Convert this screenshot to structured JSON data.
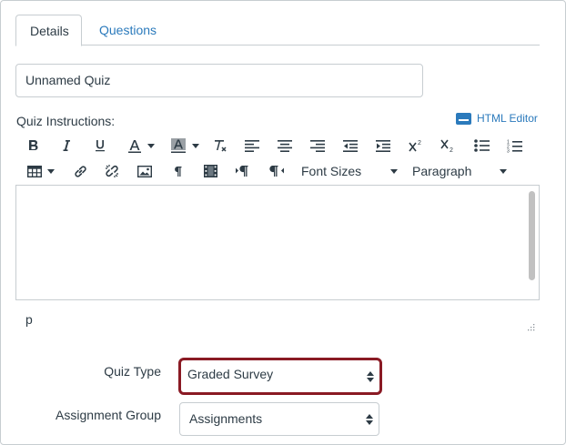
{
  "tabs": [
    {
      "label": "Details",
      "active": true
    },
    {
      "label": "Questions",
      "active": false
    }
  ],
  "quiz_title": {
    "value": "Unnamed Quiz"
  },
  "instructions": {
    "label": "Quiz Instructions:",
    "html_editor_label": "HTML Editor",
    "path_text": "p"
  },
  "toolbar": {
    "font_sizes_label": "Font Sizes",
    "paragraph_label": "Paragraph"
  },
  "quiz_type": {
    "label": "Quiz Type",
    "value": "Graded Survey"
  },
  "assignment_group": {
    "label": "Assignment Group",
    "value": "Assignments"
  },
  "colors": {
    "link": "#2b7abc",
    "focus_border": "#8a1a24",
    "border": "#c7cdd1",
    "text": "#2d3b45"
  }
}
